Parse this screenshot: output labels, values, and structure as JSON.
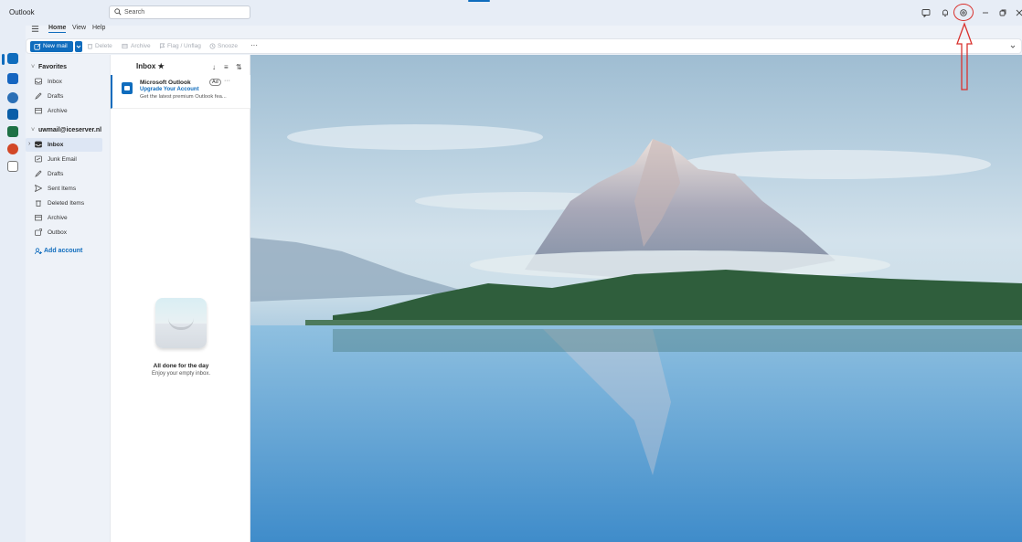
{
  "window": {
    "title": "Outlook"
  },
  "search": {
    "placeholder": "Search"
  },
  "ribbon": {
    "tabs": [
      {
        "label": "Home",
        "active": true
      },
      {
        "label": "View"
      },
      {
        "label": "Help"
      }
    ],
    "new_mail": "New mail",
    "commands": [
      "Delete",
      "Archive",
      "Flag / Unflag",
      "Snooze"
    ],
    "more": "···"
  },
  "folders": {
    "favorites_header": "Favorites",
    "favorites": [
      {
        "label": "Inbox",
        "icon": "inbox-icon"
      },
      {
        "label": "Drafts",
        "icon": "drafts-icon"
      },
      {
        "label": "Archive",
        "icon": "archive-icon"
      }
    ],
    "account": "uwmail@iceserver.nl",
    "account_folders": [
      {
        "label": "Inbox",
        "icon": "inbox-icon",
        "selected": true
      },
      {
        "label": "Junk Email",
        "icon": "junk-icon"
      },
      {
        "label": "Drafts",
        "icon": "drafts-icon"
      },
      {
        "label": "Sent Items",
        "icon": "send-icon"
      },
      {
        "label": "Deleted Items",
        "icon": "trash-icon"
      },
      {
        "label": "Archive",
        "icon": "archive-icon"
      },
      {
        "label": "Outbox",
        "icon": "outbox-icon"
      }
    ],
    "add_account": "Add account"
  },
  "message_list": {
    "header": "Inbox",
    "messages": [
      {
        "from": "Microsoft Outlook",
        "subject": "Upgrade Your Account",
        "preview": "Get the latest premium Outlook fea...",
        "tag": "Ad"
      }
    ],
    "empty_title": "All done for the day",
    "empty_subtitle": "Enjoy your empty inbox."
  },
  "colors": {
    "accent": "#0f6cbd",
    "annotation": "#d9322e"
  }
}
